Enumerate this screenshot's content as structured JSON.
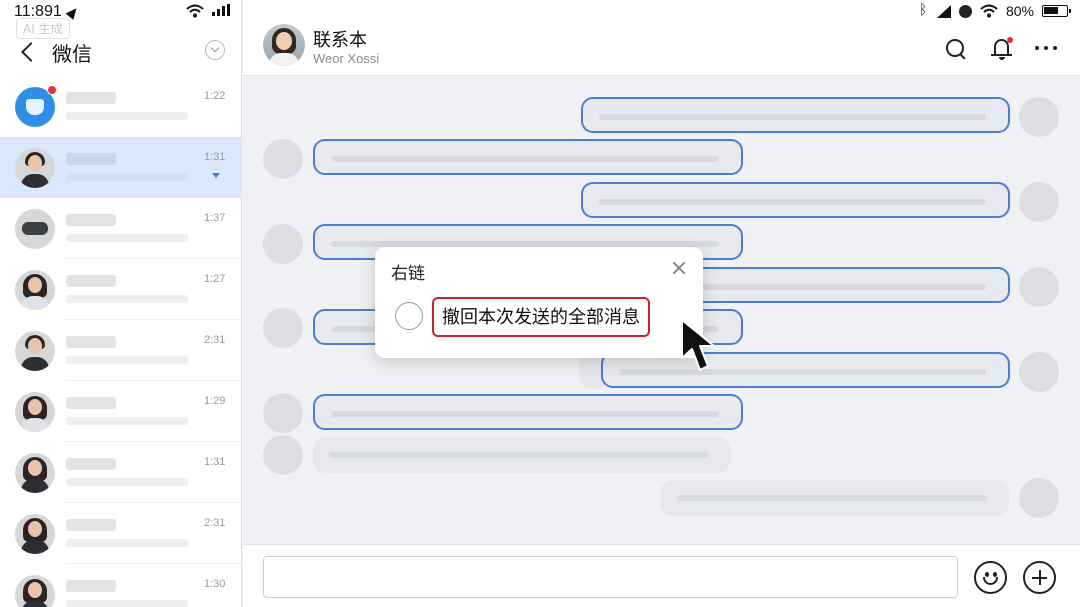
{
  "status_bar_left": {
    "time": "11:891"
  },
  "status_bar_right": {
    "battery_percent": "80%"
  },
  "ai_badge": "AI 生成",
  "sidebar": {
    "title": "微信",
    "chats": [
      {
        "time": "1:22",
        "avatar": "blue-app-icon",
        "unread": true
      },
      {
        "time": "1:31",
        "avatar": "man-suit-avatar",
        "active": true,
        "muted": true
      },
      {
        "time": "1:37",
        "avatar": "vr-headset-avatar"
      },
      {
        "time": "1:27",
        "avatar": "woman-avatar"
      },
      {
        "time": "2:31",
        "avatar": "man-avatar"
      },
      {
        "time": "1:29",
        "avatar": "woman-light-avatar"
      },
      {
        "time": "1:31",
        "avatar": "woman-avatar"
      },
      {
        "time": "2:31",
        "avatar": "woman-avatar"
      },
      {
        "time": "1:30",
        "avatar": "woman-avatar"
      }
    ]
  },
  "chat_header": {
    "name": "联系本",
    "subtitle": "Weor Xossi"
  },
  "popup": {
    "title": "右链",
    "option_label": "撤回本次发送的全部消息",
    "option_selected": false
  },
  "composer": {
    "value": "",
    "placeholder": ""
  },
  "colors": {
    "accent_blue": "#4b7fd6",
    "highlight_red": "#c9262c",
    "active_row": "#dbe8fb"
  }
}
